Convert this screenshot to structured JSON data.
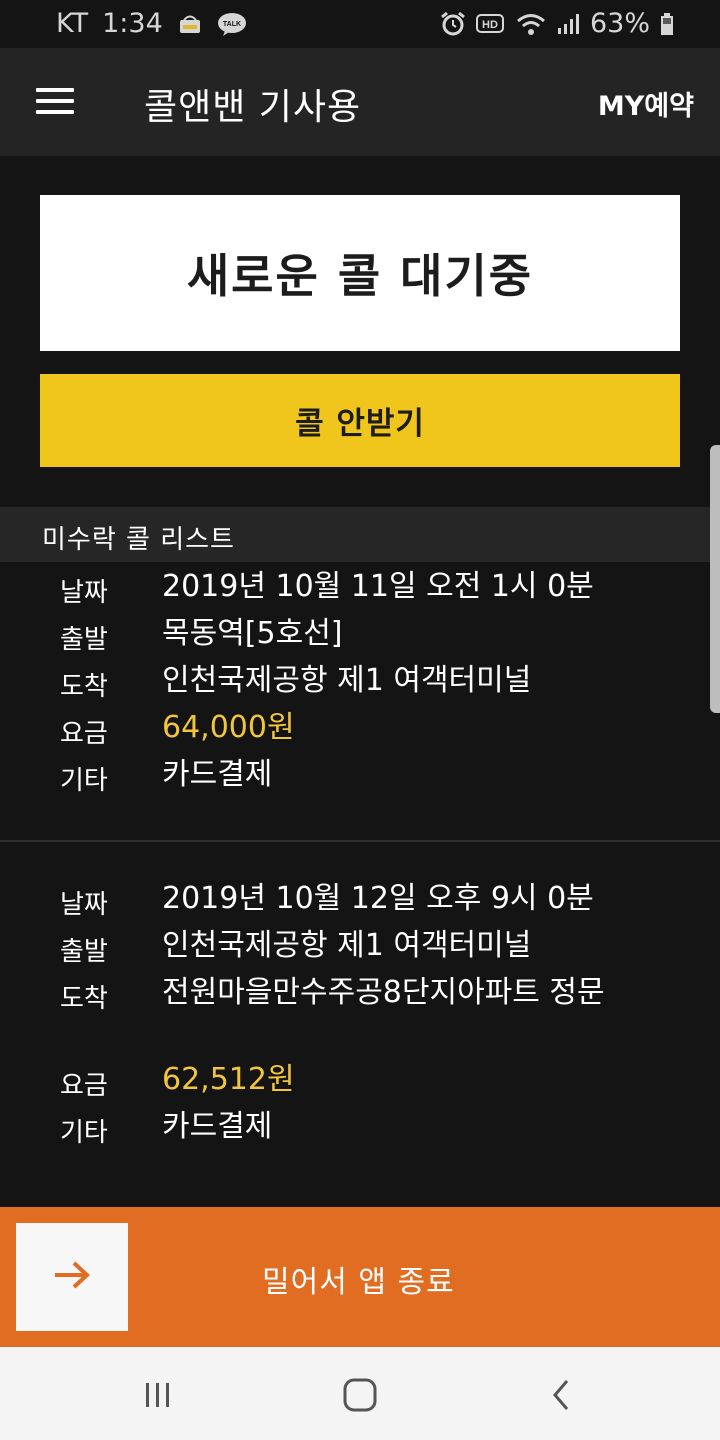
{
  "status_bar": {
    "carrier": "KT",
    "time": "1:34",
    "battery": "63%",
    "icons": [
      "notification-app-icon",
      "kakaotalk-icon",
      "alarm-icon",
      "hd-icon",
      "wifi-icon",
      "signal-icon",
      "battery-icon"
    ]
  },
  "app_bar": {
    "title": "콜앤밴 기사용",
    "my_reservation": "MY예약"
  },
  "waiting": {
    "text": "새로운 콜 대기중"
  },
  "reject_button": {
    "label": "콜 안받기"
  },
  "list": {
    "header": "미수락 콜 리스트",
    "keys": {
      "date": "날짜",
      "departure": "출발",
      "arrival": "도착",
      "fare": "요금",
      "etc": "기타"
    },
    "calls": [
      {
        "date": "2019년 10월 11일 오전 1시 0분",
        "departure": "목동역[5호선]",
        "arrival": "인천국제공항 제1 여객터미널",
        "fare": "64,000원",
        "etc": "카드결제"
      },
      {
        "date": "2019년 10월 12일 오후 9시 0분",
        "departure": "인천국제공항 제1 여객터미널",
        "arrival": "전원마을만수주공8단지아파트 정문",
        "fare": "62,512원",
        "etc": "카드결제"
      }
    ]
  },
  "exit_bar": {
    "label": "밀어서 앱 종료"
  },
  "colors": {
    "accent_yellow": "#f0c61c",
    "fare_yellow": "#f2c53a",
    "exit_orange": "#e06d22",
    "background": "#141414"
  }
}
